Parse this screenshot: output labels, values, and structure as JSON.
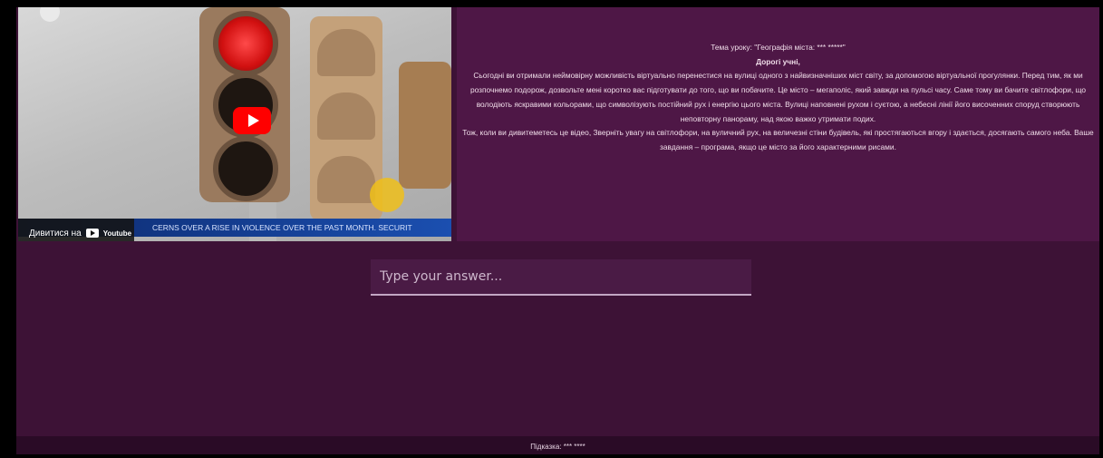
{
  "video": {
    "watch_on_label": "Дивитися на",
    "youtube_label": "Youtube",
    "ticker": "CERNS OVER A RISE IN VIOLENCE OVER THE PAST MONTH. SECURIT",
    "play_icon": "play-icon",
    "colors": {
      "play": "#ff0000",
      "ticker": "#1b4fb0"
    }
  },
  "lesson": {
    "topic": "Тема уроку: \"Географія міста: *** *****\"",
    "greeting": "Дорогі учні,",
    "paragraph_1": "Сьогодні ви отримали неймовірну можливість віртуально перенестися на вулиці одного з найвизначніших міст світу, за допомогою віртуальної прогулянки. Перед тим, як ми розпочнемо подорож, дозвольте мені коротко вас підготувати до того, що ви побачите. Це місто – мегаполіс, який завжди на пульсі часу. Саме тому ви бачите світлофори, що володіють яскравими кольорами, що символізують постійний рух і енергію цього міста. Вулиці наповнені рухом і суєтою, а небесні лінії його височенних споруд створюють неповторну панораму, над якою важко утримати подих.",
    "paragraph_2": "Тож, коли ви дивитеметесь це відео, Зверніть увагу на світлофори, на вуличний рух, на величезні стіни будівель, які простягаються вгору і здається, досягають самого неба. Ваше завдання – програма, якщо це місто за його характерними рисами."
  },
  "answer": {
    "placeholder": "Type your answer...",
    "value": ""
  },
  "footer": {
    "hint": "Підказка: *** ****"
  },
  "colors": {
    "background": "#3d1236",
    "panel": "#4e1746",
    "input_bg": "#4a1b45",
    "footer": "#2a0b26"
  }
}
